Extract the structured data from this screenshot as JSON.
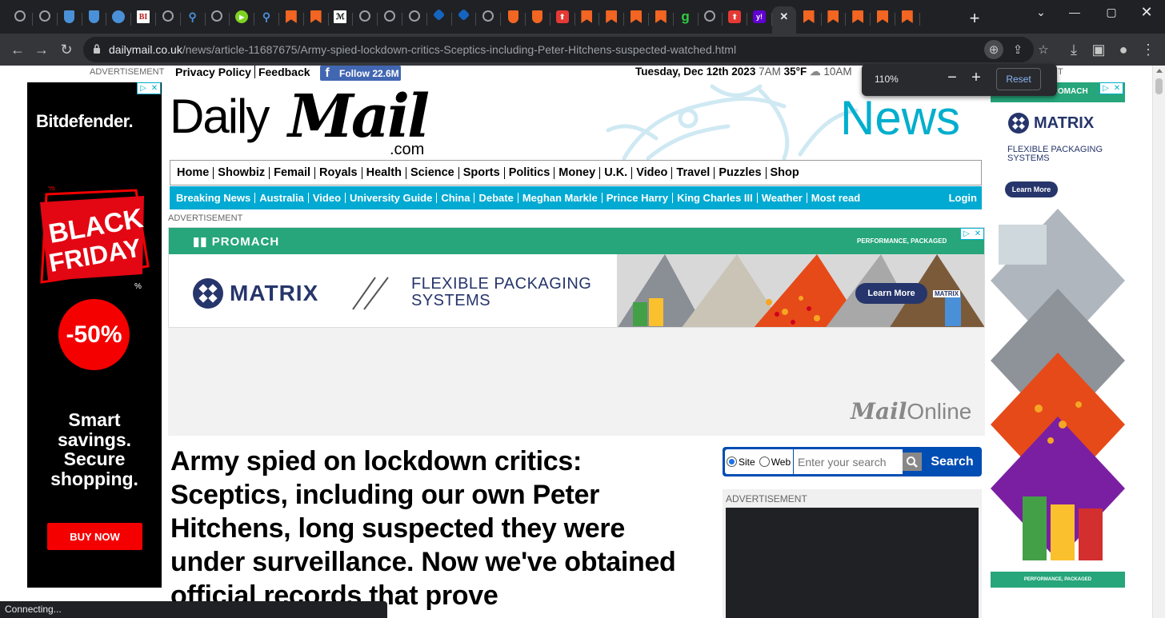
{
  "browser": {
    "tabs": [
      {
        "icon": "globe-icon",
        "color": "#9aa0a6"
      },
      {
        "icon": "globe-icon",
        "color": "#9aa0a6"
      },
      {
        "icon": "shield-icon",
        "color": "#4a90d9"
      },
      {
        "icon": "shield-icon",
        "color": "#4a90d9"
      },
      {
        "icon": "flag-icon",
        "color": "#4a90d9"
      },
      {
        "icon": "bi-icon",
        "color": "#b71c1c",
        "text": "BI"
      },
      {
        "icon": "globe-icon",
        "color": "#9aa0a6"
      },
      {
        "icon": "search-icon",
        "color": "#4a90d9"
      },
      {
        "icon": "globe-icon",
        "color": "#9aa0a6"
      },
      {
        "icon": "play-icon",
        "color": "#7ed321"
      },
      {
        "icon": "search-icon",
        "color": "#4a90d9"
      },
      {
        "icon": "bookmark-icon",
        "color": "#f26522"
      },
      {
        "icon": "bookmark-icon",
        "color": "#f26522"
      },
      {
        "icon": "medium-icon",
        "color": "#ffffff"
      },
      {
        "icon": "globe-icon",
        "color": "#9aa0a6"
      },
      {
        "icon": "globe-icon",
        "color": "#9aa0a6"
      },
      {
        "icon": "globe-icon",
        "color": "#9aa0a6"
      },
      {
        "icon": "cube-icon",
        "color": "#1565c0"
      },
      {
        "icon": "cube-icon",
        "color": "#1565c0"
      },
      {
        "icon": "globe-icon",
        "color": "#9aa0a6"
      },
      {
        "icon": "shield-icon",
        "color": "#f26522"
      },
      {
        "icon": "shield-icon",
        "color": "#f26522"
      },
      {
        "icon": "pin-icon",
        "color": "#e53935"
      },
      {
        "icon": "bookmark-icon",
        "color": "#f26522"
      },
      {
        "icon": "bookmark-icon",
        "color": "#f26522"
      },
      {
        "icon": "bookmark-icon",
        "color": "#f26522"
      },
      {
        "icon": "bookmark-icon",
        "color": "#f26522"
      },
      {
        "icon": "g-icon",
        "color": "#2ecc40",
        "text": "g"
      },
      {
        "icon": "globe-icon",
        "color": "#9aa0a6"
      },
      {
        "icon": "pin-icon",
        "color": "#e53935"
      },
      {
        "icon": "yahoo-icon",
        "color": "#6001d2",
        "text": "y!"
      },
      {
        "icon": "close-icon",
        "color": "#e8eaed",
        "active": true
      },
      {
        "icon": "bookmark-icon",
        "color": "#f26522"
      },
      {
        "icon": "bookmark-icon",
        "color": "#f26522"
      },
      {
        "icon": "bookmark-icon",
        "color": "#f26522"
      },
      {
        "icon": "bookmark-icon",
        "color": "#f26522"
      },
      {
        "icon": "bookmark-icon",
        "color": "#f26522"
      }
    ],
    "url_domain": "dailymail.co.uk",
    "url_path": "/news/article-11687675/Army-spied-lockdown-critics-Sceptics-including-Peter-Hitchens-suspected-watched.html",
    "zoom": {
      "level": "110%",
      "minus": "−",
      "plus": "+",
      "reset": "Reset"
    },
    "status": "Connecting..."
  },
  "page": {
    "ad_label": "ADVERTISEMENT",
    "top_links": [
      "Privacy Policy",
      "Feedback"
    ],
    "facebook": {
      "label": "Follow 22.6M",
      "glyph": "f"
    },
    "date": "Tuesday, Dec 12th 2023",
    "time_now": "7AM",
    "temp": "35°F",
    "time_later": "10AM",
    "masthead": {
      "daily": "Daily",
      "mail": "Mail",
      "com": ".com",
      "section": "News"
    },
    "main_nav": [
      "Home",
      "Showbiz",
      "Femail",
      "Royals",
      "Health",
      "Science",
      "Sports",
      "Politics",
      "Money",
      "U.K.",
      "Video",
      "Travel",
      "Puzzles",
      "Shop"
    ],
    "sub_nav": [
      "Breaking News",
      "Australia",
      "Video",
      "University Guide",
      "China",
      "Debate",
      "Meghan Markle",
      "Prince Harry",
      "King Charles III",
      "Weather",
      "Most read"
    ],
    "login": "Login",
    "headline": "Army spied on lockdown critics: Sceptics, including our own Peter Hitchens, long suspected they were under surveillance. Now we've obtained official records that prove",
    "mailonline": {
      "mail": "Mail",
      "online": "Online"
    },
    "search": {
      "site": "Site",
      "web": "Web",
      "placeholder": "Enter your search",
      "button": "Search"
    }
  },
  "left_ad": {
    "brand": "Bitdefender.",
    "badge_line1": "BLACK",
    "badge_line2": "FRIDAY",
    "discount": "-50%",
    "slogan": [
      "Smart",
      "savings.",
      "Secure",
      "shopping."
    ],
    "cta": "BUY NOW"
  },
  "leader_ad": {
    "brand": "PROMACH",
    "tagline": "PERFORMANCE, PACKAGED",
    "product": "MATRIX",
    "product_sub": "FLEXIBLE PACKAGING SYSTEMS",
    "cta": "Learn More",
    "machine_label": "MATRIX"
  },
  "right_ad": {
    "brand": "PROMACH",
    "product": "MATRIX",
    "product_sub": "FLEXIBLE PACKAGING SYSTEMS",
    "cta": "Learn More",
    "tagline": "PERFORMANCE, PACKAGED"
  }
}
